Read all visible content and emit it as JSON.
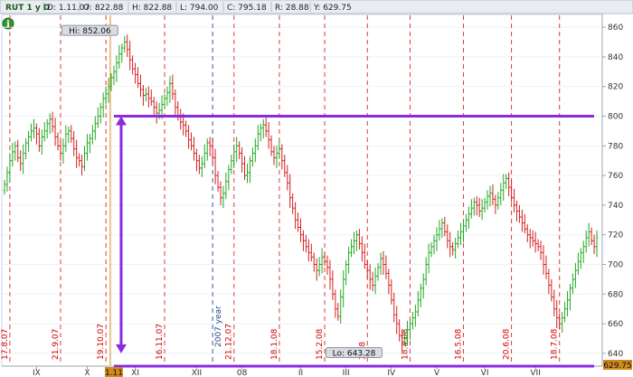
{
  "header": {
    "symbol": "RUT 1 y D",
    "fields": [
      "D: 1.11.07",
      "O: 822.88",
      "H: 822.88",
      "L: 794.00",
      "C: 795.18",
      "R: 28.88",
      "Y: 629.75"
    ],
    "info_icon": "info-icon"
  },
  "colors": {
    "up": "#22a822",
    "down": "#d42020",
    "vline": "#e23a3a",
    "year_line": "#3a5a9a",
    "annotation": "#8a2be2",
    "price_tag": "#d08a20"
  },
  "chart_data": {
    "type": "candlestick",
    "ylim": [
      632,
      868
    ],
    "y_ticks": [
      640,
      660,
      680,
      700,
      720,
      740,
      760,
      780,
      800,
      820,
      840,
      860
    ],
    "x_month_labels": [
      "IX",
      "X",
      "XI",
      "XII",
      "08",
      "II",
      "III",
      "IV",
      "V",
      "VI",
      "VII"
    ],
    "date_marks": [
      "17.8.07",
      "21.9.07",
      "19.10.07",
      "16.11.07",
      "21.12.07",
      "18.1.08",
      "15.2.08",
      "3.08",
      "18.4.08",
      "16.5.08",
      "20.6.08",
      "18.7.08"
    ],
    "year_label": "2007 year",
    "hi": {
      "label": "Hi: 852.06",
      "value": 852.06
    },
    "lo": {
      "label": "Lo: 643.28",
      "value": 643.28
    },
    "current_price": "629.75",
    "x_cursor_label": "1.11",
    "annotation_level": 800,
    "annotation_arrow": {
      "from": 800,
      "to": 640
    },
    "closes": [
      754,
      762,
      770,
      776,
      780,
      772,
      768,
      775,
      782,
      786,
      790,
      792,
      788,
      780,
      786,
      790,
      795,
      798,
      793,
      786,
      780,
      775,
      780,
      788,
      790,
      785,
      778,
      772,
      770,
      766,
      775,
      782,
      785,
      790,
      795,
      800,
      806,
      812,
      815,
      820,
      826,
      830,
      836,
      842,
      846,
      850,
      845,
      838,
      832,
      828,
      822,
      818,
      814,
      815,
      812,
      810,
      806,
      802,
      804,
      808,
      812,
      816,
      822,
      815,
      806,
      800,
      796,
      794,
      790,
      784,
      780,
      775,
      770,
      765,
      768,
      775,
      782,
      780,
      772,
      760,
      752,
      745,
      748,
      756,
      764,
      770,
      776,
      780,
      775,
      768,
      760,
      762,
      770,
      775,
      780,
      788,
      792,
      794,
      790,
      784,
      776,
      772,
      775,
      778,
      770,
      762,
      755,
      745,
      738,
      730,
      725,
      720,
      716,
      712,
      708,
      705,
      700,
      696,
      700,
      705,
      702,
      698,
      690,
      680,
      670,
      665,
      678,
      690,
      700,
      708,
      712,
      716,
      720,
      714,
      708,
      700,
      696,
      690,
      686,
      692,
      698,
      704,
      700,
      694,
      686,
      676,
      666,
      660,
      652,
      648,
      650,
      656,
      660,
      664,
      668,
      676,
      684,
      690,
      700,
      708,
      712,
      716,
      720,
      724,
      728,
      722,
      716,
      712,
      710,
      714,
      718,
      722,
      726,
      730,
      734,
      738,
      742,
      740,
      736,
      738,
      742,
      746,
      748,
      744,
      740,
      745,
      750,
      755,
      758,
      752,
      745,
      740,
      736,
      732,
      728,
      724,
      720,
      718,
      716,
      714,
      712,
      708,
      700,
      694,
      686,
      678,
      670,
      664,
      660,
      664,
      670,
      676,
      684,
      690,
      696,
      702,
      708,
      712,
      718,
      722,
      716,
      712,
      718
    ]
  }
}
